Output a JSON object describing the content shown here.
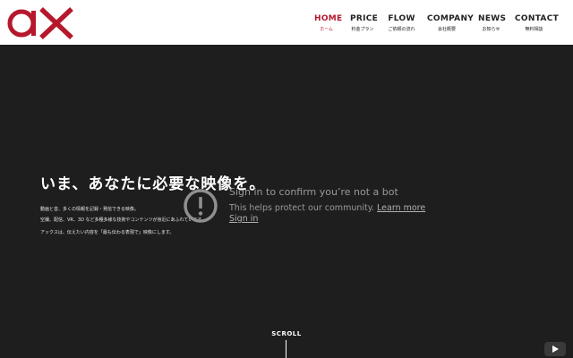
{
  "header": {
    "logo_text": "ax",
    "brand_color": "#b5182c",
    "nav": [
      {
        "en": "HOME",
        "ja": "ホーム"
      },
      {
        "en": "PRICE",
        "ja": "料金プラン"
      },
      {
        "en": "FLOW",
        "ja": "ご依頼の流れ"
      },
      {
        "en": "COMPANY",
        "ja": "会社概要"
      },
      {
        "en": "NEWS",
        "ja": "お知らせ"
      },
      {
        "en": "CONTACT",
        "ja": "無料相談"
      }
    ],
    "active_index": 0
  },
  "hero": {
    "heading": "いま、あなたに必要な映像を。",
    "lines": [
      "動画と音、多くの情報を記録・発信できる映像。",
      "空撮、配信、VR、3D など多種多様な技術やコンテンツが身近にあふれています。",
      "アックスは、伝えたい内容を「最も伝わる表現で」映像にします。"
    ]
  },
  "overlay": {
    "icon": "alert-circle-icon",
    "title": "Sign in to confirm you’re not a bot",
    "text": "This helps protect our community.",
    "learn_more": "Learn more",
    "sign_in": "Sign in"
  },
  "scroll": {
    "label": "SCROLL"
  },
  "corner_widget": {
    "icon": "play-icon"
  }
}
